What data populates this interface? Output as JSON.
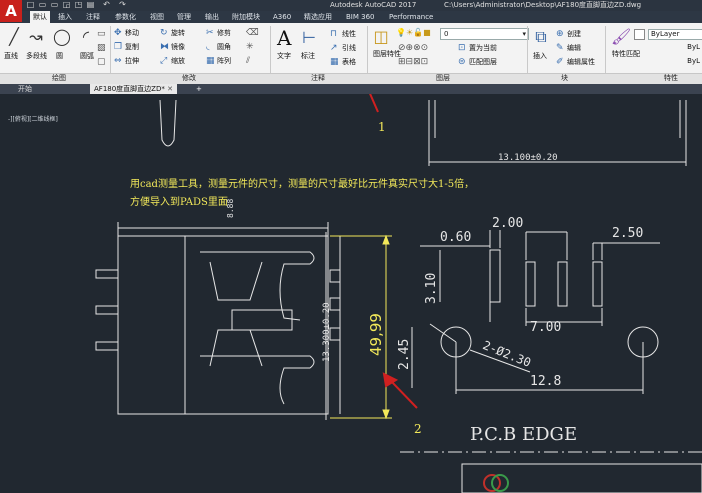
{
  "titlebar": {
    "app_logo": "A",
    "app_title": "Autodesk AutoCAD 2017",
    "file_path": "C:\\Users\\Administrator\\Desktop\\AF180度直脚直边ZD.dwg",
    "quick_access": [
      "□",
      "▭",
      "▭",
      "◲",
      "◳",
      "▤",
      "↶",
      "↷"
    ]
  },
  "ribbon_tabs": [
    "默认",
    "插入",
    "注释",
    "参数化",
    "视图",
    "管理",
    "输出",
    "附加模块",
    "A360",
    "精选应用",
    "BIM 360",
    "Performance"
  ],
  "ribbon": {
    "draw": {
      "line": "直线",
      "polyline": "多段线",
      "circle": "圆",
      "arc": "圆弧",
      "panel_label": "绘图"
    },
    "modify": {
      "move": "移动",
      "rotate": "旋转",
      "trim": "修剪",
      "copy": "复制",
      "mirror": "镜像",
      "fillet": "圆角",
      "stretch": "拉伸",
      "scale": "缩放",
      "array": "阵列",
      "panel_label": "修改"
    },
    "annotation": {
      "text": "文字",
      "dimension": "标注",
      "linear": "线性",
      "leader": "引线",
      "table": "表格",
      "panel_label": "注释"
    },
    "layers": {
      "layer_properties": "图层特性",
      "current_layer": "0",
      "set_current": "置为当前",
      "match_layer": "匹配图层",
      "panel_label": "图层"
    },
    "block": {
      "insert": "插入",
      "create": "创建",
      "edit": "编辑",
      "edit_attributes": "编辑属性",
      "panel_label": "块"
    },
    "properties": {
      "match_properties": "特性匹配",
      "bylayer_1": "ByLayer",
      "bylayer_2": "ByL",
      "bylayer_3": "ByL",
      "panel_label": "特性"
    }
  },
  "file_tabs": {
    "start": "开始",
    "active": "AF180度直脚直边ZD*",
    "add": "+"
  },
  "viewport_label": "-][俯视][二维线框]",
  "drawing": {
    "note_line1": "用cad测量工具，测量元件的尺寸，测量的尺寸最好比元件真实尺寸大1-5倍，",
    "note_line2": "方便导入到PADS里面",
    "callout_1": "1",
    "callout_2": "2",
    "dim_top_width": "13.100±0.20",
    "dim_side": "13.300±0.20",
    "dim_measured": "49,99",
    "dim_small": "8.88",
    "pcb": {
      "d1": "0.60",
      "d2": "2.00",
      "d3": "2.50",
      "d4": "3.10",
      "d5": "7.00",
      "d6": "2.45",
      "d7": "2-Ø2.30",
      "d8": "12.8",
      "edge_label": "P.C.B EDGE"
    }
  },
  "colors": {
    "canvas_bg": "#212830",
    "note_yellow": "#f3e95a",
    "arrow_red": "#d02020",
    "dim_line": "#e6e6e6"
  }
}
